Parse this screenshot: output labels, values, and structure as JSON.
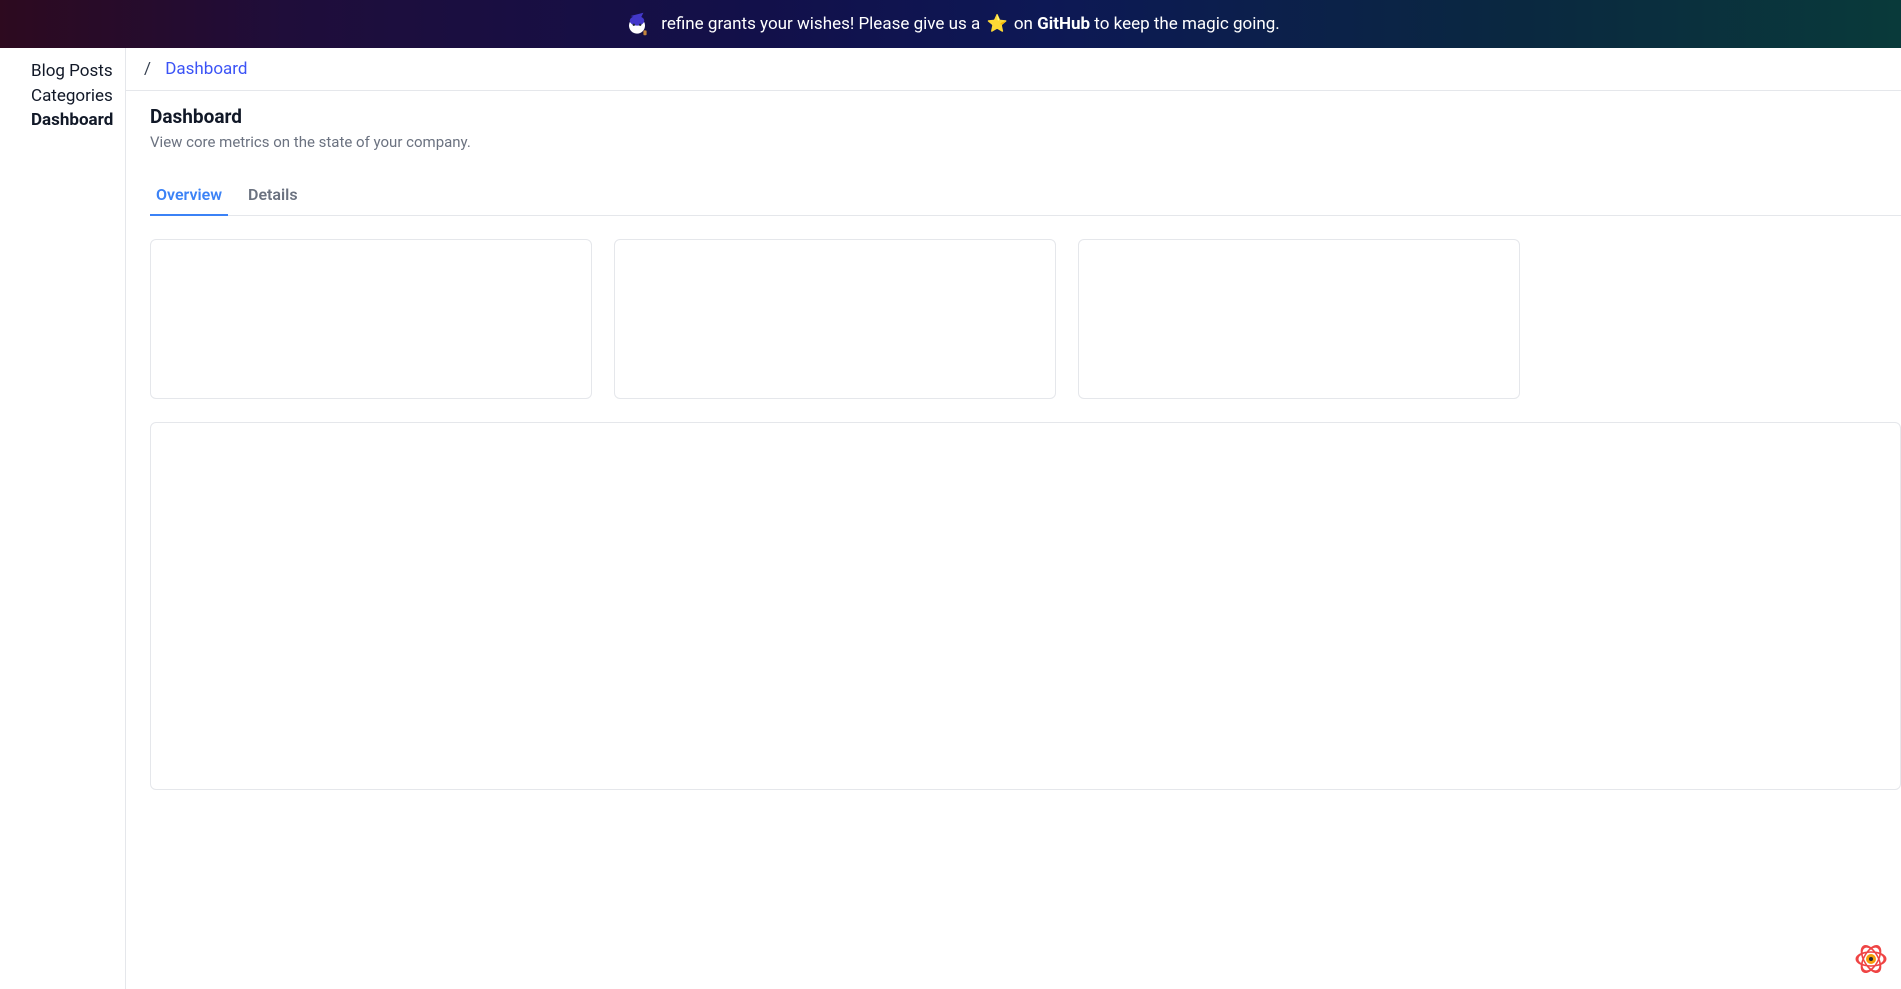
{
  "banner": {
    "text_before": "refine grants your wishes! Please give us a ",
    "star": "⭐",
    "text_after": " on ",
    "github": "GitHub",
    "text_end": " to keep the magic going."
  },
  "sidebar": {
    "items": [
      {
        "label": "Blog Posts",
        "active": false
      },
      {
        "label": "Categories",
        "active": false
      },
      {
        "label": "Dashboard",
        "active": true
      }
    ]
  },
  "breadcrumb": {
    "separator": "/",
    "current": "Dashboard"
  },
  "page": {
    "title": "Dashboard",
    "subtitle": "View core metrics on the state of your company."
  },
  "tabs": [
    {
      "label": "Overview",
      "active": true
    },
    {
      "label": "Details",
      "active": false
    }
  ]
}
